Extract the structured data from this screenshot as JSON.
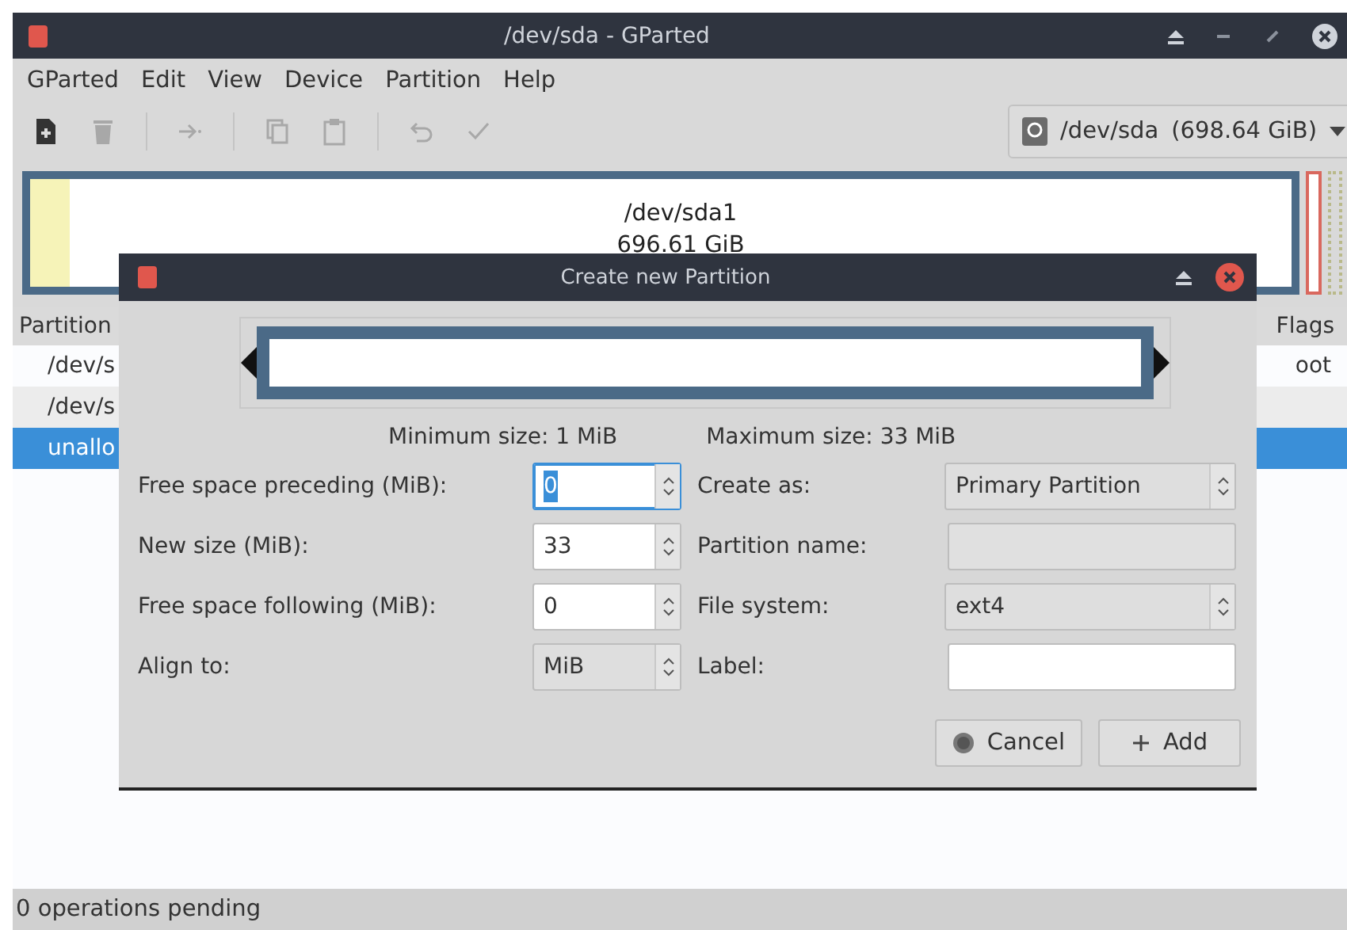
{
  "window": {
    "title": "/dev/sda - GParted"
  },
  "menu": [
    "GParted",
    "Edit",
    "View",
    "Device",
    "Partition",
    "Help"
  ],
  "toolbar": [
    {
      "kind": "new",
      "disabled": false
    },
    {
      "kind": "delete",
      "disabled": true
    },
    {
      "kind": "sep"
    },
    {
      "kind": "resize",
      "disabled": true
    },
    {
      "kind": "sep"
    },
    {
      "kind": "copy",
      "disabled": true
    },
    {
      "kind": "paste",
      "disabled": true
    },
    {
      "kind": "sep"
    },
    {
      "kind": "undo",
      "disabled": true
    },
    {
      "kind": "apply",
      "disabled": true
    }
  ],
  "device_selector": {
    "device": "/dev/sda",
    "size": "(698.64 GiB)"
  },
  "disk_map": {
    "partition": "/dev/sda1",
    "size": "696.61 GiB"
  },
  "partition_list": {
    "columns": [
      "Partition",
      "Flags"
    ],
    "rows": [
      {
        "partition": "/dev/s",
        "flags": "oot",
        "selected": false
      },
      {
        "partition": "/dev/s",
        "flags": "",
        "selected": false
      },
      {
        "partition": "unallo",
        "flags": "",
        "selected": true
      }
    ]
  },
  "status_bar": "0 operations pending",
  "dialog": {
    "title": "Create new Partition",
    "min_size": "Minimum size: 1 MiB",
    "max_size": "Maximum size: 33 MiB",
    "left_fields": [
      {
        "label": "Free space preceding (MiB):",
        "kind": "spin",
        "value": "0",
        "focused": true
      },
      {
        "label": "New size (MiB):",
        "kind": "spin",
        "value": "33",
        "focused": false
      },
      {
        "label": "Free space following (MiB):",
        "kind": "spin",
        "value": "0",
        "focused": false
      },
      {
        "label": "Align to:",
        "kind": "combo",
        "value": "MiB"
      }
    ],
    "right_fields": [
      {
        "label": "Create as:",
        "kind": "combo",
        "value": "Primary Partition",
        "disabled": false
      },
      {
        "label": "Partition name:",
        "kind": "entry",
        "disabled": true
      },
      {
        "label": "File system:",
        "kind": "combo",
        "value": "ext4",
        "disabled": false
      },
      {
        "label": "Label:",
        "kind": "entry",
        "disabled": false
      }
    ],
    "buttons": [
      {
        "kind": "cancel",
        "label": "Cancel"
      },
      {
        "kind": "add",
        "label": "Add"
      }
    ]
  }
}
